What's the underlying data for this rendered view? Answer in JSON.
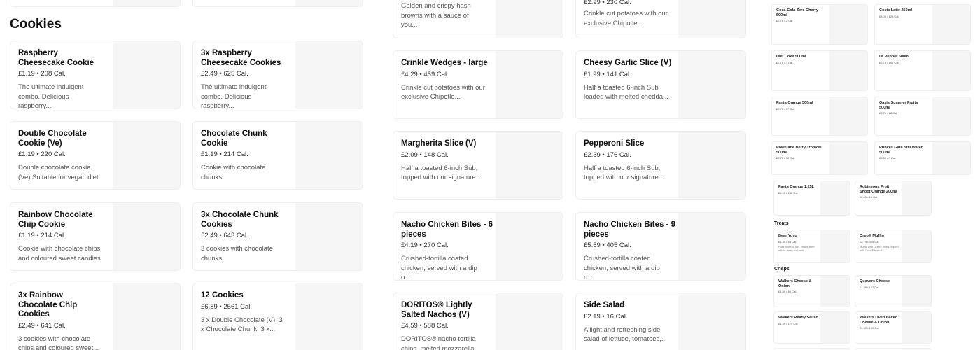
{
  "left_section": {
    "heading": "Cookies",
    "items": [
      {
        "name": "Raspberry Cheesecake Cookie",
        "price": "£1.19",
        "cal": "208 Cal.",
        "desc": "The ultimate indulgent combo. Delicious raspberry..."
      },
      {
        "name": "3x Raspberry Cheesecake Cookies",
        "price": "£2.49",
        "cal": "625 Cal.",
        "desc": "The ultimate indulgent combo. Delicious raspberry..."
      },
      {
        "name": "Double Chocolate Cookie (Ve)",
        "price": "£1.19",
        "cal": "220 Cal.",
        "desc": "Double chocolate cookie. (Ve) Suitable for vegan diet."
      },
      {
        "name": "Chocolate Chunk Cookie",
        "price": "£1.19",
        "cal": "214 Cal.",
        "desc": "Cookie with chocolate chunks"
      },
      {
        "name": "Rainbow Chocolate Chip Cookie",
        "price": "£1.19",
        "cal": "214 Cal.",
        "desc": "Cookie with chocolate chips and coloured sweet candies"
      },
      {
        "name": "3x Chocolate Chunk Cookies",
        "price": "£2.49",
        "cal": "643 Cal.",
        "desc": "3 cookies with chocolate chunks"
      },
      {
        "name": "3x  Rainbow Chocolate Chip Cookies",
        "price": "£2.49",
        "cal": "641 Cal.",
        "desc": "3 cookies with chocolate chips and coloured sweet..."
      },
      {
        "name": "12 Cookies",
        "price": "£6.89",
        "cal": "2561 Cal.",
        "desc": "3 x Double Chocolate (V), 3 x Chocolate Chunk, 3 x..."
      }
    ]
  },
  "middle_section": {
    "items": [
      {
        "name": "",
        "price": "",
        "cal": "",
        "desc": "Golden and crispy hash browns with a sauce of you..."
      },
      {
        "name": "",
        "price": "£2.99",
        "cal": "230 Cal.",
        "desc": "Crinkle cut potatoes with our exclusive Chipotle..."
      },
      {
        "name": "Crinkle Wedges - large",
        "price": "£4.29",
        "cal": "459 Cal.",
        "desc": "Crinkle cut potatoes with our exclusive Chipotle..."
      },
      {
        "name": "Cheesy Garlic Slice (V)",
        "price": "£1.99",
        "cal": "141 Cal.",
        "desc": "Half a toasted 6-inch Sub loaded with melted chedda..."
      },
      {
        "name": "Margherita Slice (V)",
        "price": "£2.09",
        "cal": "148 Cal.",
        "desc": "Half a toasted 6-inch Sub, topped with our signature..."
      },
      {
        "name": "Pepperoni Slice",
        "price": "£2.39",
        "cal": "176 Cal.",
        "desc": "Half a toasted 6-inch Sub, topped with our signature..."
      },
      {
        "name": "Nacho Chicken Bites - 6 pieces",
        "price": "£4.19",
        "cal": "270 Cal.",
        "desc": "Crushed-tortilla coated chicken, served with a dip o..."
      },
      {
        "name": "Nacho Chicken Bites - 9 pieces",
        "price": "£5.59",
        "cal": "405 Cal.",
        "desc": "Crushed-tortilla coated chicken, served with a dip o..."
      },
      {
        "name": "DORITOS® Lightly Salted Nachos (V)",
        "price": "£4.59",
        "cal": "588 Cal.",
        "desc": "DORITOS® nacho tortilla chips, melted mozzarella..."
      },
      {
        "name": "Side Salad",
        "price": "£2.19",
        "cal": "16 Cal.",
        "desc": "A light and refreshing side salad of lettuce, tomatoes,..."
      }
    ]
  },
  "right_section": {
    "drinks": [
      {
        "name": "Coca-Cola Zero Cherry 500ml",
        "price": "£2.79",
        "cal": "2 Cal."
      },
      {
        "name": "Costa Latte 250ml",
        "price": "£3.09",
        "cal": "124 Cal."
      },
      {
        "name": "Diet Coke 500ml",
        "price": "£2.79",
        "cal": "3 Cal."
      },
      {
        "name": "Dr Pepper 500ml",
        "price": "£2.79",
        "cal": "102 Cal."
      },
      {
        "name": "Fanta Orange 500ml",
        "price": "£2.79",
        "cal": "97 Cal."
      },
      {
        "name": "Oasis Summer Fruits 500ml",
        "price": "£2.79",
        "cal": "68 Cal."
      },
      {
        "name": "Powerade Berry Tropical 500ml",
        "price": "£2.79",
        "cal": "92 Cal."
      },
      {
        "name": "Princes Gate Still Water 500ml",
        "price": "£2.39",
        "cal": "0 Cal."
      },
      {
        "name": "Fanta Orange 1.25L",
        "price": "£3.99",
        "cal": "242 Cal."
      },
      {
        "name": "Robinsons Fruit Shoot Orange 200ml",
        "price": "£2.09",
        "cal": "10 Cal."
      }
    ],
    "treats_heading": "Treats",
    "treats": [
      {
        "name": "Bear Yoyo",
        "price": "£1.39",
        "cal": "53 Cal.",
        "desc": "Pure fruit roll ups, made from whole fresh fruit and..."
      },
      {
        "name": "Oreo® Muffin",
        "price": "£2.79",
        "cal": "405 Cal.",
        "desc": "Muffin with Oreo® filling, topped with Oreo® biscuit..."
      }
    ],
    "crisps_heading": "Crisps",
    "crisps": [
      {
        "name": "Walkers Cheese & Onion",
        "price": "£1.39",
        "cal": "86 Cal."
      },
      {
        "name": "Quavers Cheese",
        "price": "£1.39",
        "cal": "107 Cal."
      },
      {
        "name": "Walkers Ready Salted",
        "price": "£1.39",
        "cal": "170 Cal."
      },
      {
        "name": "Walkers Oven Baked Cheese & Onion",
        "price": "£1.39",
        "cal": "109 Cal."
      }
    ]
  }
}
